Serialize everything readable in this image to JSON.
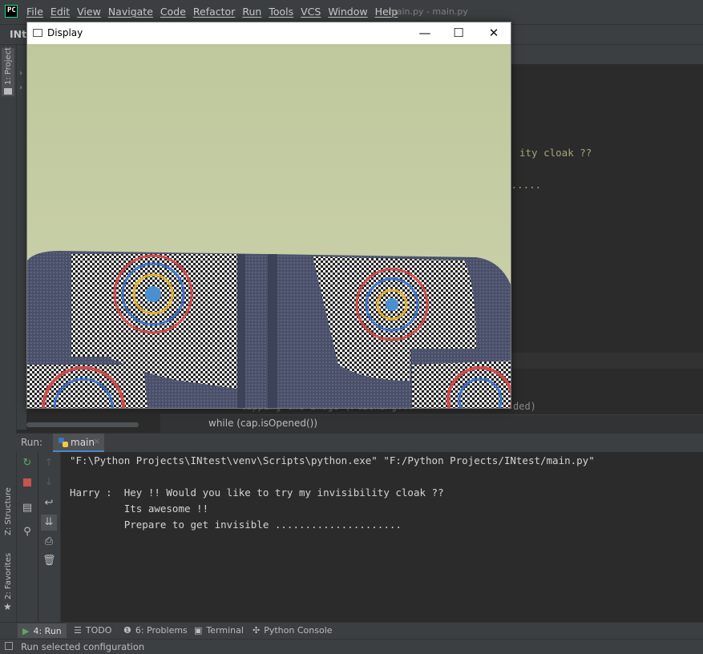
{
  "menubar": {
    "items": [
      "File",
      "Edit",
      "View",
      "Navigate",
      "Code",
      "Refactor",
      "Run",
      "Tools",
      "VCS",
      "Window",
      "Help"
    ],
    "title": "main.py - main.py"
  },
  "navbar": {
    "project": "INte"
  },
  "left_stripe": {
    "project_label": "1: Project",
    "structure_label": "Z: Structure",
    "favorites_label": "2: Favorites"
  },
  "editor": {
    "line1": "ity cloak ??",
    "line2": "......",
    "hidden_left": "lipping the image (Flicking...",
    "hidden_right": "ded)",
    "breadcrumb": "while (cap.isOpened())"
  },
  "display_window": {
    "title": "Display",
    "minimize": "—",
    "maximize": "☐",
    "close": "✕"
  },
  "run_panel": {
    "label": "Run:",
    "tab_label": "main",
    "console_lines": [
      "\"F:\\Python Projects\\INtest\\venv\\Scripts\\python.exe\" \"F:/Python Projects/INtest/main.py\"",
      "",
      "Harry :  Hey !! Would you like to try my invisibility cloak ??",
      "         Its awesome !!",
      "         Prepare to get invisible ....................."
    ]
  },
  "bottom_tools": {
    "run": "4: Run",
    "todo": "TODO",
    "problems": "6: Problems",
    "terminal": "Terminal",
    "python_console": "Python Console"
  },
  "status": {
    "text": "Run selected configuration"
  },
  "colors": {
    "accent": "#4a88c7",
    "stop": "#c75450",
    "rerun": "#59a869",
    "wall": "#c9d0a8"
  }
}
